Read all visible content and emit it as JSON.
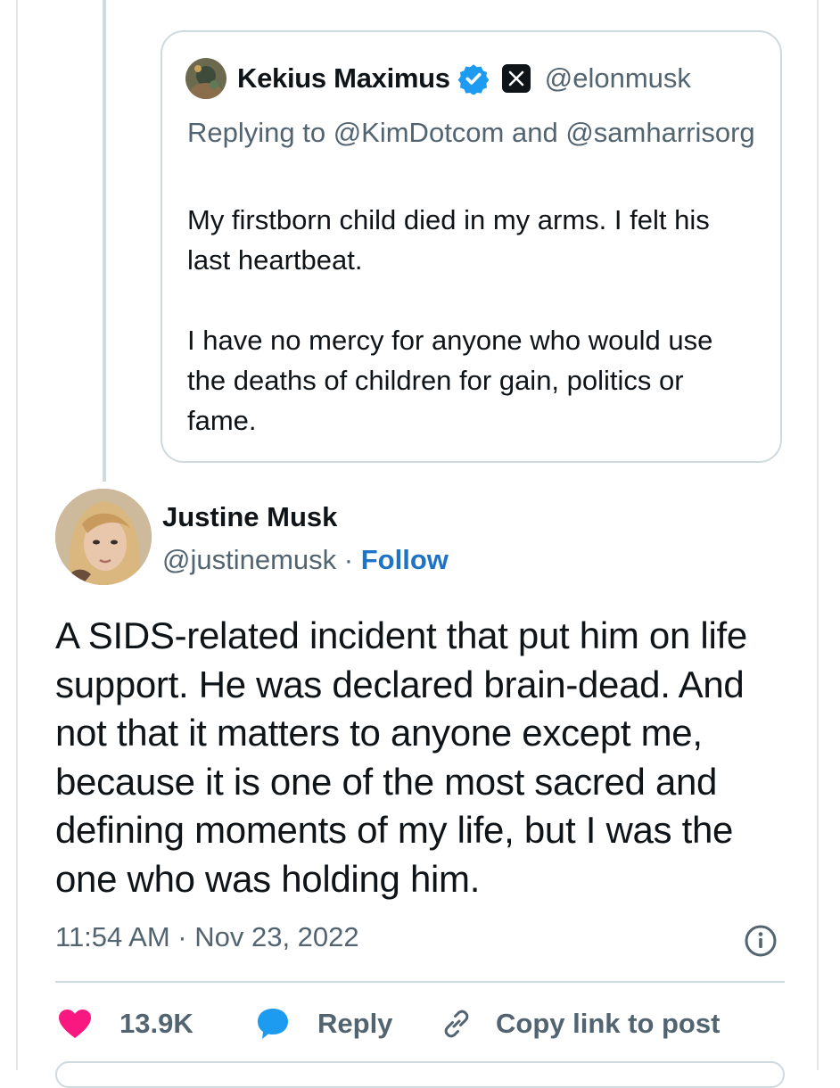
{
  "quoted_post": {
    "name": "Kekius Maximus",
    "handle": "@elonmusk",
    "replying_to": "Replying to @KimDotcom and @samharrisorg",
    "paragraphs": [
      "My firstborn child died in my arms. I felt his last heartbeat.",
      "I have no mercy for anyone who would use the deaths of children for gain, politics or fame."
    ]
  },
  "post": {
    "name": "Justine Musk",
    "handle": "@justinemusk",
    "separator": "·",
    "follow_label": "Follow",
    "text": "A SIDS-related incident that put him on life support. He was declared brain-dead. And not that it matters to anyone except me, because it is one of the most sacred and defining moments of my life, but I was the one who was holding him.",
    "timestamp": "11:54 AM · Nov 23, 2022"
  },
  "actions": {
    "like_count": "13.9K",
    "reply_label": "Reply",
    "copy_link_label": "Copy link to post"
  },
  "colors": {
    "accent": "#1d74c7",
    "verified": "#1d9bf0",
    "like": "#f91880",
    "secondary_text": "#536471",
    "border": "#cfd9de"
  },
  "icons": [
    "verified-badge-icon",
    "x-logo-icon",
    "info-icon",
    "heart-icon",
    "speech-bubble-icon",
    "link-icon"
  ]
}
